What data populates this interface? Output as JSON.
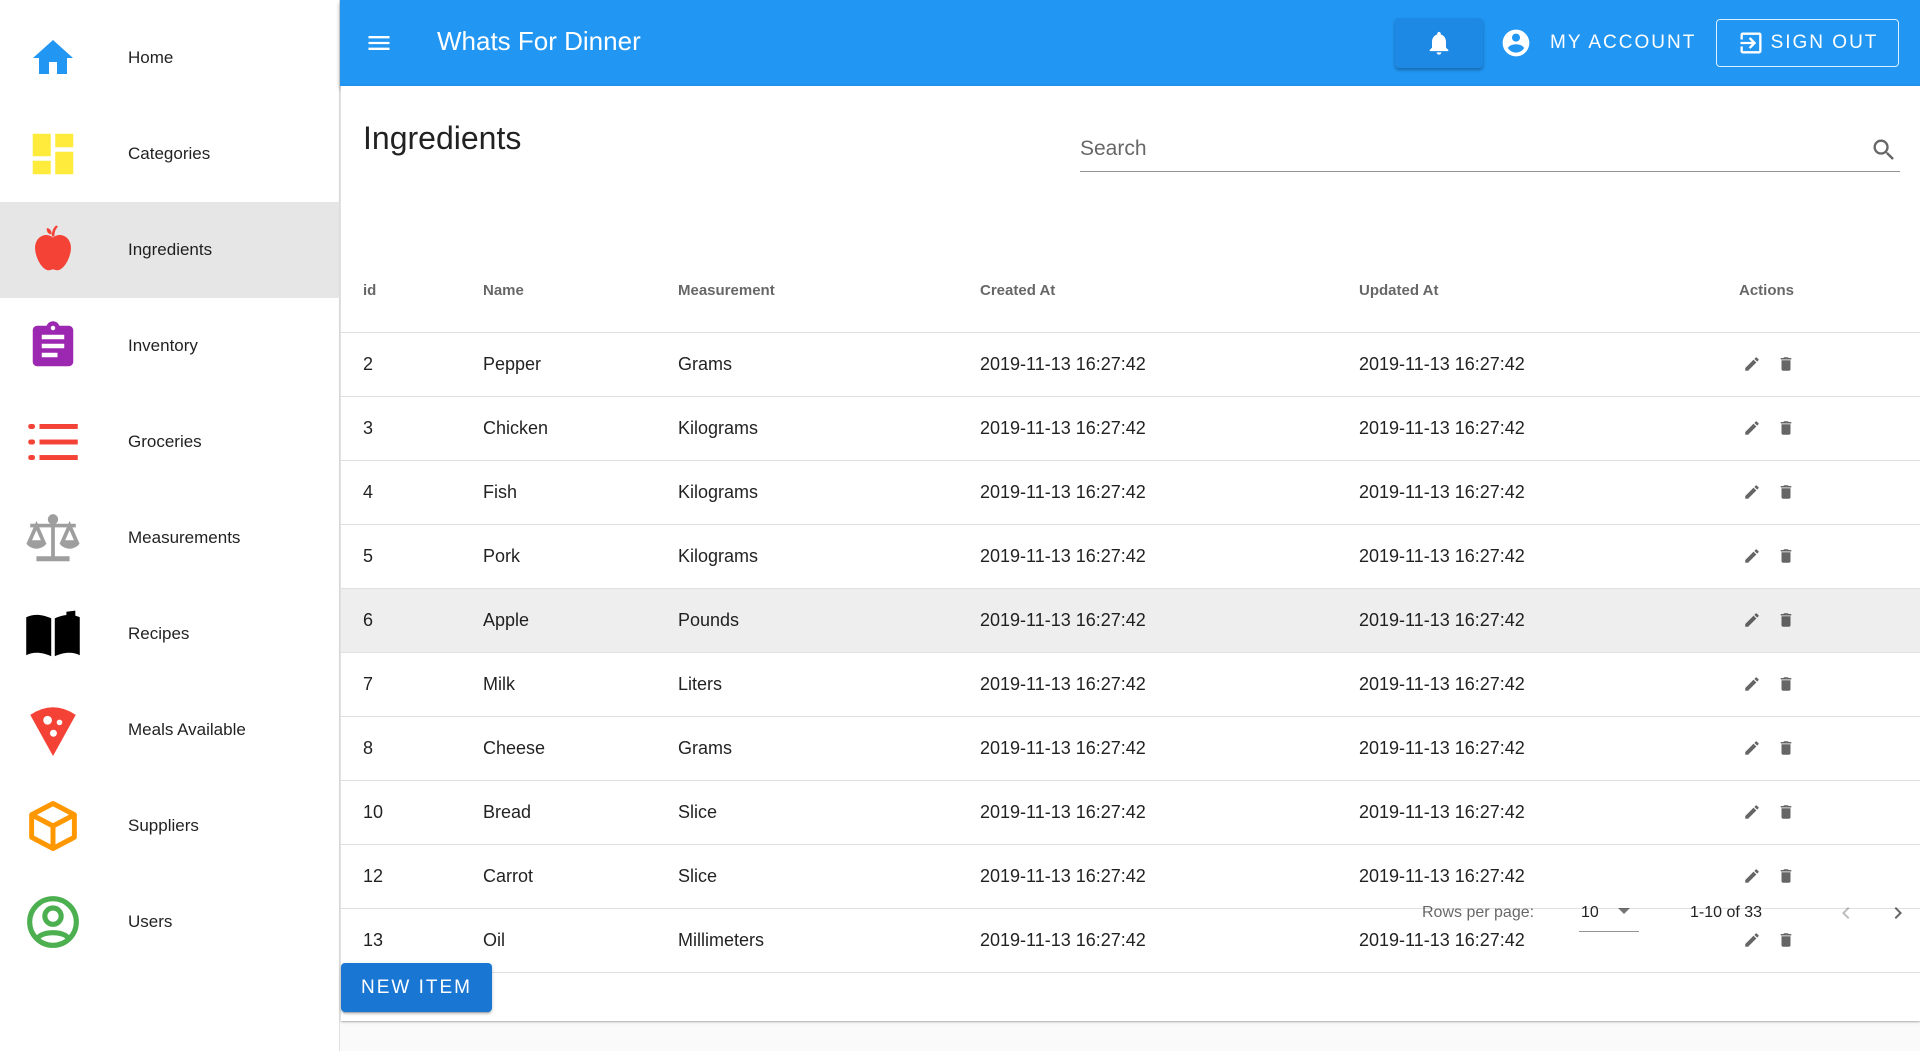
{
  "app": {
    "title": "Whats For Dinner",
    "account_label": "MY ACCOUNT",
    "signout_label": "SIGN OUT",
    "accent_color": "#2196f3"
  },
  "sidebar": {
    "items": [
      {
        "label": "Home",
        "icon": "home-icon",
        "color": "#2196f3"
      },
      {
        "label": "Categories",
        "icon": "dashboard-icon",
        "color": "#ffeb3b"
      },
      {
        "label": "Ingredients",
        "icon": "apple-icon",
        "color": "#f44336",
        "active": true
      },
      {
        "label": "Inventory",
        "icon": "clipboard-icon",
        "color": "#9c27b0"
      },
      {
        "label": "Groceries",
        "icon": "list-icon",
        "color": "#f44336"
      },
      {
        "label": "Measurements",
        "icon": "scale-icon",
        "color": "#9e9e9e"
      },
      {
        "label": "Recipes",
        "icon": "book-icon",
        "color": "#000000"
      },
      {
        "label": "Meals Available",
        "icon": "pizza-icon",
        "color": "#f44336"
      },
      {
        "label": "Suppliers",
        "icon": "box-icon",
        "color": "#ff9800"
      },
      {
        "label": "Users",
        "icon": "user-circle-icon",
        "color": "#4caf50"
      }
    ]
  },
  "main": {
    "title": "Ingredients",
    "search_placeholder": "Search",
    "columns": [
      "id",
      "Name",
      "Measurement",
      "Created At",
      "Updated At",
      "Actions"
    ],
    "rows": [
      {
        "id": "2",
        "name": "Pepper",
        "measurement": "Grams",
        "created": "2019-11-13 16:27:42",
        "updated": "2019-11-13 16:27:42"
      },
      {
        "id": "3",
        "name": "Chicken",
        "measurement": "Kilograms",
        "created": "2019-11-13 16:27:42",
        "updated": "2019-11-13 16:27:42"
      },
      {
        "id": "4",
        "name": "Fish",
        "measurement": "Kilograms",
        "created": "2019-11-13 16:27:42",
        "updated": "2019-11-13 16:27:42"
      },
      {
        "id": "5",
        "name": "Pork",
        "measurement": "Kilograms",
        "created": "2019-11-13 16:27:42",
        "updated": "2019-11-13 16:27:42"
      },
      {
        "id": "6",
        "name": "Apple",
        "measurement": "Pounds",
        "created": "2019-11-13 16:27:42",
        "updated": "2019-11-13 16:27:42",
        "highlight": true
      },
      {
        "id": "7",
        "name": "Milk",
        "measurement": "Liters",
        "created": "2019-11-13 16:27:42",
        "updated": "2019-11-13 16:27:42"
      },
      {
        "id": "8",
        "name": "Cheese",
        "measurement": "Grams",
        "created": "2019-11-13 16:27:42",
        "updated": "2019-11-13 16:27:42"
      },
      {
        "id": "10",
        "name": "Bread",
        "measurement": "Slice",
        "created": "2019-11-13 16:27:42",
        "updated": "2019-11-13 16:27:42"
      },
      {
        "id": "12",
        "name": "Carrot",
        "measurement": "Slice",
        "created": "2019-11-13 16:27:42",
        "updated": "2019-11-13 16:27:42"
      },
      {
        "id": "13",
        "name": "Oil",
        "measurement": "Millimeters",
        "created": "2019-11-13 16:27:42",
        "updated": "2019-11-13 16:27:42"
      }
    ],
    "pagination": {
      "rows_per_page_label": "Rows per page:",
      "rows_per_page": "10",
      "range": "1-10 of 33"
    },
    "new_item_label": "NEW ITEM"
  }
}
